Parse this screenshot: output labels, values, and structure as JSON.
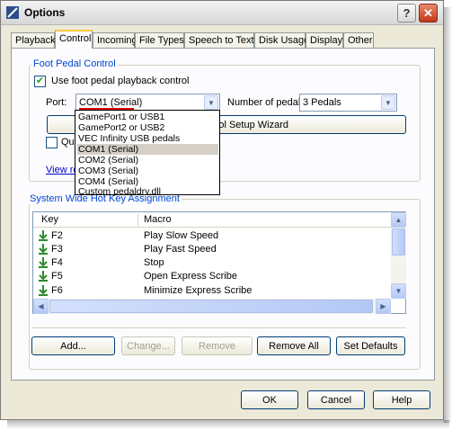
{
  "window": {
    "title": "Options"
  },
  "tabs": [
    {
      "label": "Playback"
    },
    {
      "label": "Control"
    },
    {
      "label": "Incoming"
    },
    {
      "label": "File Types"
    },
    {
      "label": "Speech to Text"
    },
    {
      "label": "Disk Usage"
    },
    {
      "label": "Display"
    },
    {
      "label": "Other"
    }
  ],
  "active_tab": "Control",
  "foot_pedal": {
    "group_label": "Foot Pedal Control",
    "use_checkbox_label": "Use foot pedal playback control",
    "use_checked": true,
    "port_label": "Port:",
    "port_value": "COM1 (Serial)",
    "pedals_label": "Number of pedals:",
    "pedals_value": "3 Pedals",
    "wizard_button_label": "Foot Pedal Control Setup Wizard",
    "wizard_visible_text": "ntrol Setup Wizard",
    "quick_checkbox_partial": "Quic",
    "quick_checked": false,
    "view_link_partial": "View re"
  },
  "port_dropdown": {
    "options": [
      "GamePort1 or USB1",
      "GamePort2 or USB2",
      "VEC Infinity USB pedals",
      "COM1 (Serial)",
      "COM2 (Serial)",
      "COM3 (Serial)",
      "COM4 (Serial)",
      "Custom pedaldrv.dll"
    ],
    "selected": "COM1 (Serial)"
  },
  "hotkeys": {
    "group_label": "System Wide Hot Key Assignment",
    "columns": [
      "Key",
      "Macro"
    ],
    "rows": [
      {
        "key": "F2",
        "macro": "Play Slow Speed"
      },
      {
        "key": "F3",
        "macro": "Play Fast Speed"
      },
      {
        "key": "F4",
        "macro": "Stop"
      },
      {
        "key": "F5",
        "macro": "Open Express Scribe"
      },
      {
        "key": "F6",
        "macro": "Minimize Express Scribe"
      }
    ],
    "buttons": {
      "add": "Add...",
      "change": "Change...",
      "remove": "Remove",
      "remove_all": "Remove All",
      "set_defaults": "Set Defaults"
    }
  },
  "dialog_buttons": {
    "ok": "OK",
    "cancel": "Cancel",
    "help": "Help"
  },
  "titlebar_buttons": {
    "help": "?",
    "close": "✕"
  },
  "colors": {
    "accent": "#0046d5",
    "checkmark": "#21a121",
    "highlight_underline": "#e00000"
  },
  "icons": [
    "options-window-icon",
    "help-icon",
    "close-icon",
    "chevron-down-icon",
    "hotkey-arrow-icon",
    "scroll-up-icon",
    "scroll-down-icon",
    "scroll-left-icon",
    "scroll-right-icon"
  ]
}
